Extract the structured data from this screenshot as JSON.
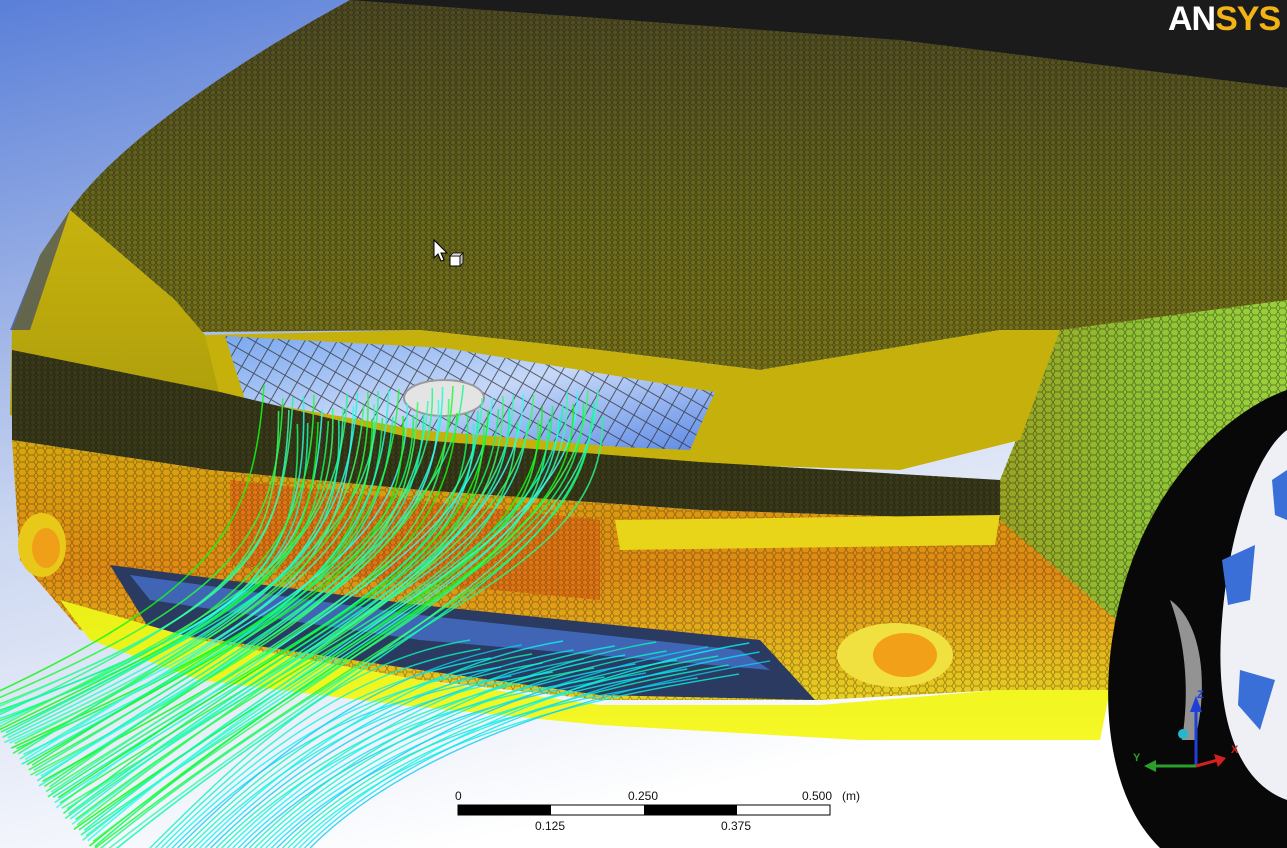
{
  "brand": {
    "logo_part1": "AN",
    "logo_part2": "SYS",
    "logo_color": "#f2b414"
  },
  "viewport": {
    "scene": "car-front-mesh-with-streamlines",
    "background_top": "#6f8ed9",
    "background_bottom": "#ffffff"
  },
  "scale_bar": {
    "labels_top": [
      "0",
      "0.250",
      "0.500"
    ],
    "labels_bottom": [
      "0.125",
      "0.375"
    ],
    "unit": "(m)"
  },
  "triad": {
    "z_label": "Z",
    "y_label": "Y",
    "x_label": "X",
    "z_color": "#1f3fd6",
    "y_color": "#2aa02a",
    "x_color": "#d42020"
  },
  "cursor": {
    "icon": "rotate-cursor-icon"
  }
}
